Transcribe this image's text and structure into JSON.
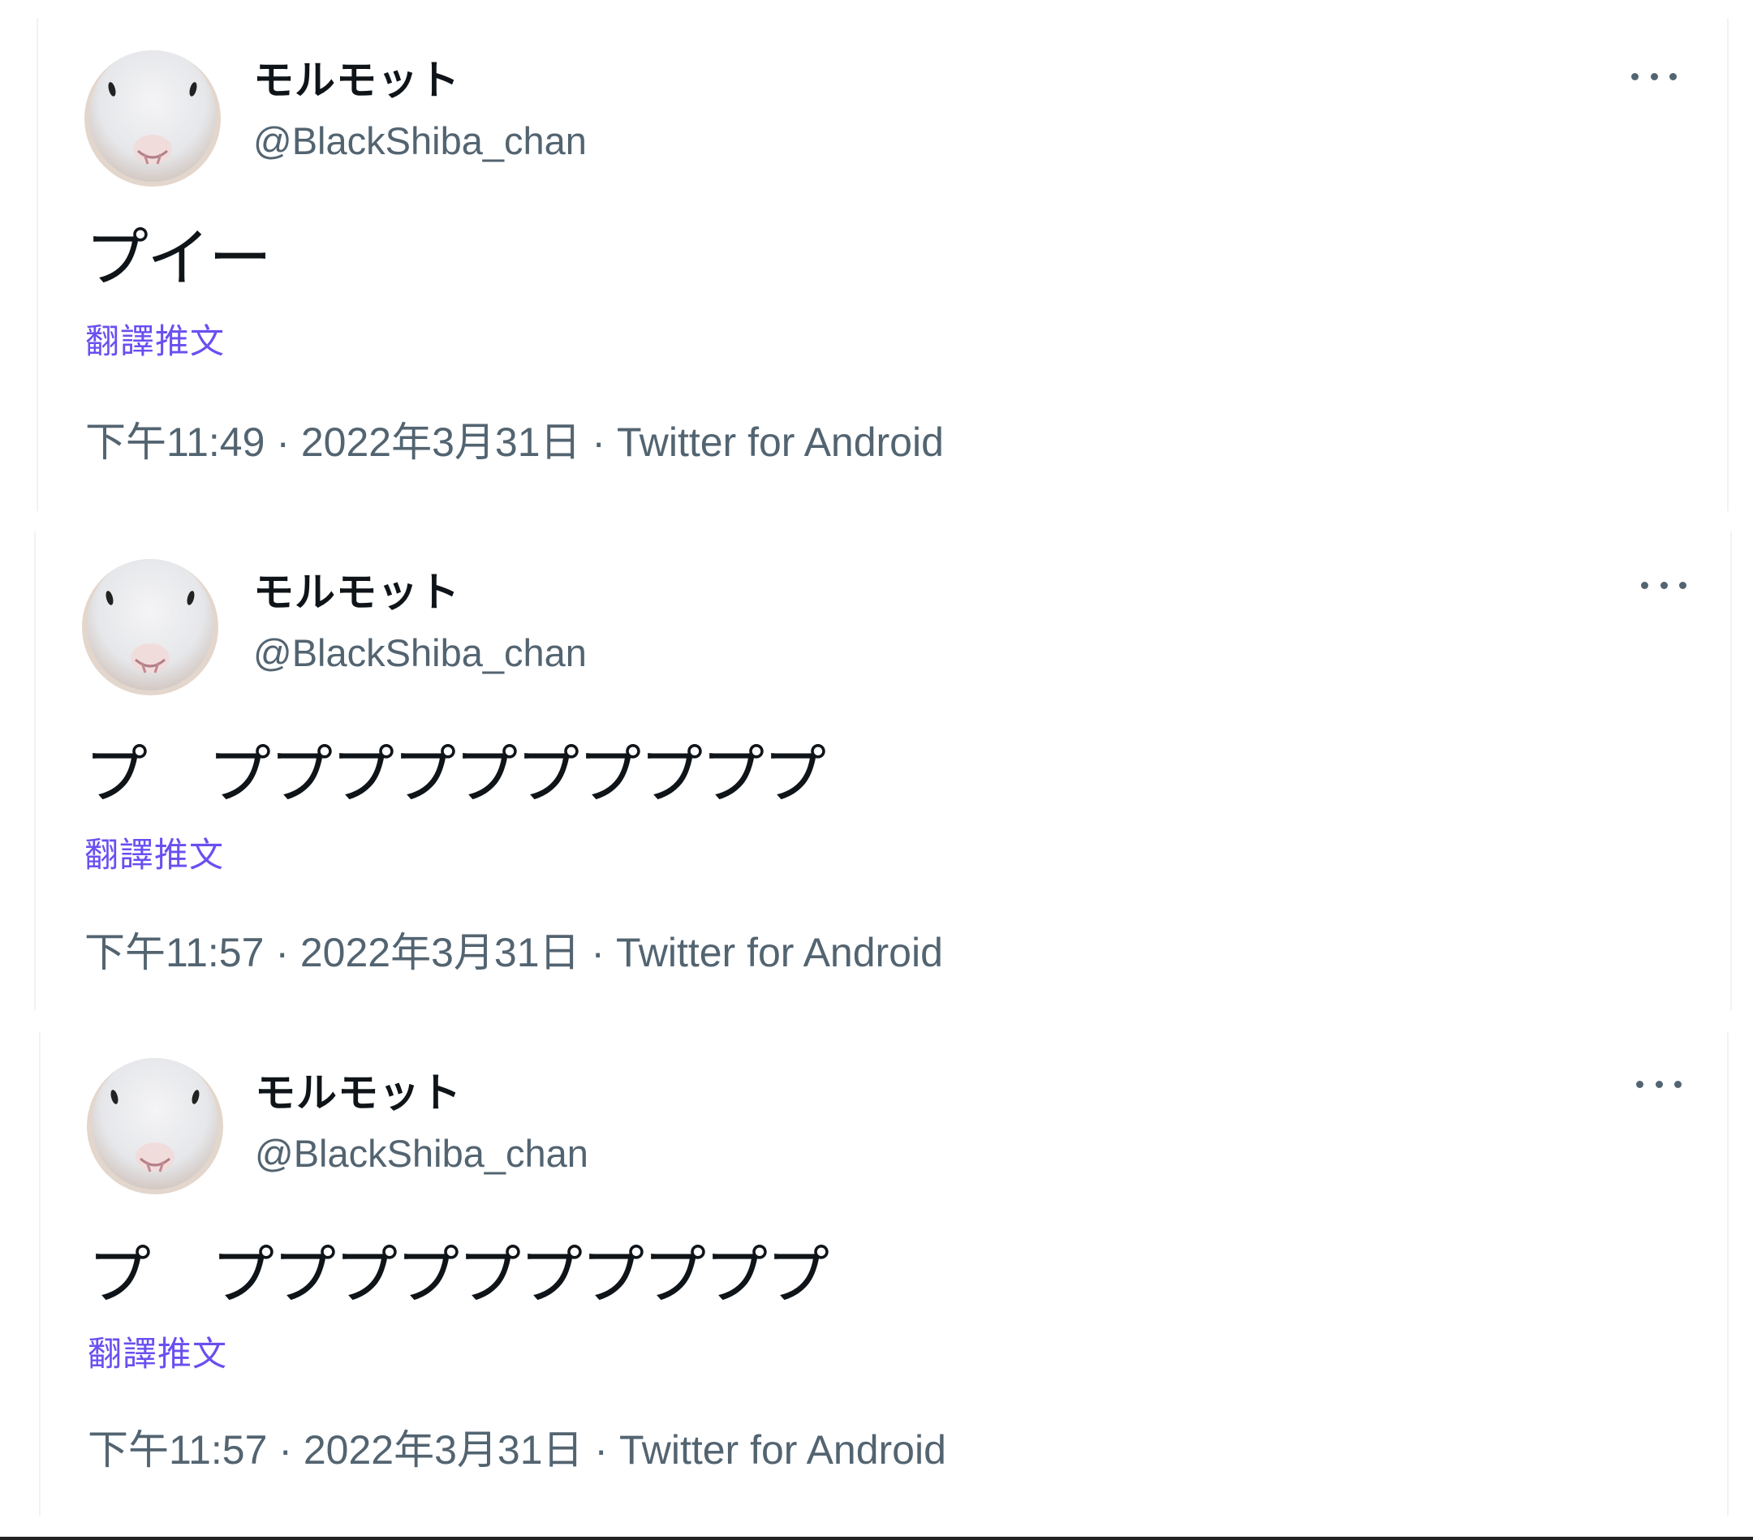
{
  "colors": {
    "text_primary": "#0f1419",
    "text_secondary": "#536471",
    "translate_link": "#6a4ff0",
    "background": "#ffffff"
  },
  "tweets": [
    {
      "author": {
        "display_name": "モルモット",
        "handle": "@BlackShiba_chan",
        "avatar_icon": "guinea-pig-avatar"
      },
      "text": "プイー",
      "translate_label": "翻譯推文",
      "time": "下午11:49",
      "date": "2022年3月31日",
      "source": "Twitter for Android",
      "more_icon": "more-options-icon"
    },
    {
      "author": {
        "display_name": "モルモット",
        "handle": "@BlackShiba_chan",
        "avatar_icon": "guinea-pig-avatar"
      },
      "text": "プ　ププププププププププ",
      "translate_label": "翻譯推文",
      "time": "下午11:57",
      "date": "2022年3月31日",
      "source": "Twitter for Android",
      "more_icon": "more-options-icon"
    },
    {
      "author": {
        "display_name": "モルモット",
        "handle": "@BlackShiba_chan",
        "avatar_icon": "guinea-pig-avatar"
      },
      "text": "プ　ププププププププププ",
      "translate_label": "翻譯推文",
      "time": "下午11:57",
      "date": "2022年3月31日",
      "source": "Twitter for Android",
      "more_icon": "more-options-icon"
    }
  ],
  "separator": " · "
}
